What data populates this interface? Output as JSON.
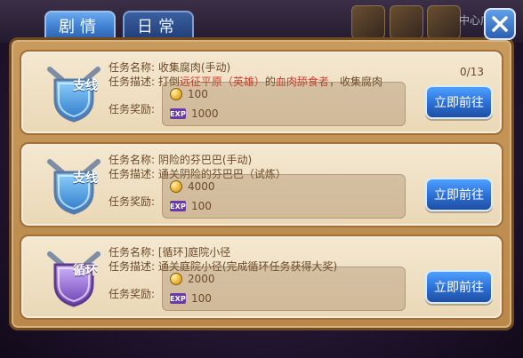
{
  "colors": {
    "accent_red": "#d23a2a",
    "panel_gold": "#c89a5c",
    "row_bg": "#f4e8d1",
    "tab_active": "#3e7fd0",
    "tab_inactive": "#213f78",
    "button_blue": "#2b6fd4"
  },
  "tabs": [
    {
      "label": "剧情",
      "state": "selected"
    },
    {
      "label": "日常",
      "state": "normal"
    }
  ],
  "background": {
    "top_right_text": "中心广场"
  },
  "labels": {
    "task_name": "任务名称:",
    "task_desc": "任务描述:",
    "task_reward": "任务奖励:"
  },
  "rows": [
    {
      "emblem_text": "支线",
      "emblem_icon": "shield-crossed-swords-icon",
      "name": "收集腐肉(手动)",
      "desc_prefix": "打倒",
      "desc_red_1": "远征平原（英雄）",
      "desc_mid": "的",
      "desc_red_2": "血肉舔食者",
      "desc_suffix": "，收集腐肉",
      "progress": "0/13",
      "reward_gold": "100",
      "reward_exp": "1000",
      "exp_badge": "EXP",
      "button": "立即前往"
    },
    {
      "emblem_text": "支线",
      "emblem_icon": "shield-crossed-swords-icon",
      "name": "阴险的芬巴巴(手动)",
      "desc": "通关阴险的芬巴巴（试炼）",
      "progress": "",
      "reward_gold": "4000",
      "reward_exp": "100",
      "exp_badge": "EXP",
      "button": "立即前往"
    },
    {
      "emblem_text": "循环",
      "emblem_icon": "shield-crossed-swords-icon",
      "name": "[循环]庭院小径",
      "desc": "通关庭院小径(完成循环任务获得大奖)",
      "progress": "",
      "reward_gold": "2000",
      "reward_exp": "100",
      "exp_badge": "EXP",
      "button": "立即前往"
    }
  ]
}
